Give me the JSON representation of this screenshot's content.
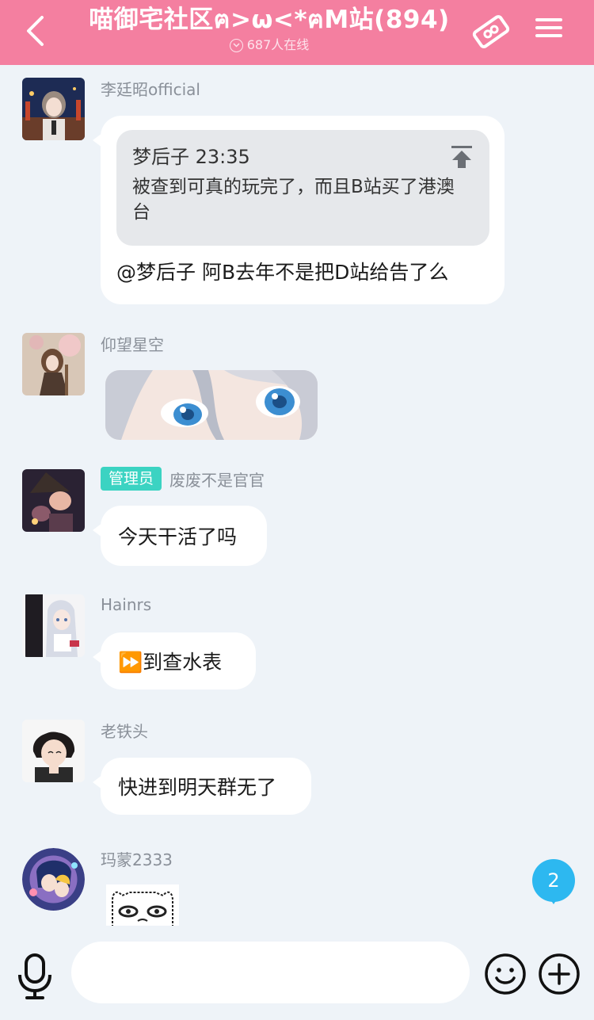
{
  "header": {
    "title": "喵御宅社区ฅ>ω<*ฅM站(894)",
    "online_count": "687人在线"
  },
  "messages": [
    {
      "sender": "李廷昭official",
      "quote": {
        "author_time": "梦后子 23:35",
        "text": "被查到可真的玩完了，而且B站买了港澳台"
      },
      "text": "@梦后子 阿B去年不是把D站给告了么"
    },
    {
      "sender": "仰望星空",
      "type": "sticker"
    },
    {
      "sender": "废废不是官官",
      "badge": "管理员",
      "text": "今天干活了吗"
    },
    {
      "sender": "Hainrs",
      "text": "⏩到查水表"
    },
    {
      "sender": "老铁头",
      "text": "快进到明天群无了"
    },
    {
      "sender": "玛蒙2333",
      "type": "sticker"
    }
  ],
  "unread_count": "2",
  "composer": {
    "placeholder": ""
  },
  "colors": {
    "header": "#f47fa0",
    "admin_badge": "#3bd3c2",
    "unread": "#2db8f0",
    "background": "#eef3f8"
  },
  "icons": [
    "back-icon",
    "ticket-icon",
    "menu-icon",
    "mic-icon",
    "emoji-icon",
    "plus-icon",
    "pin-top-icon",
    "chevron-down-icon"
  ]
}
